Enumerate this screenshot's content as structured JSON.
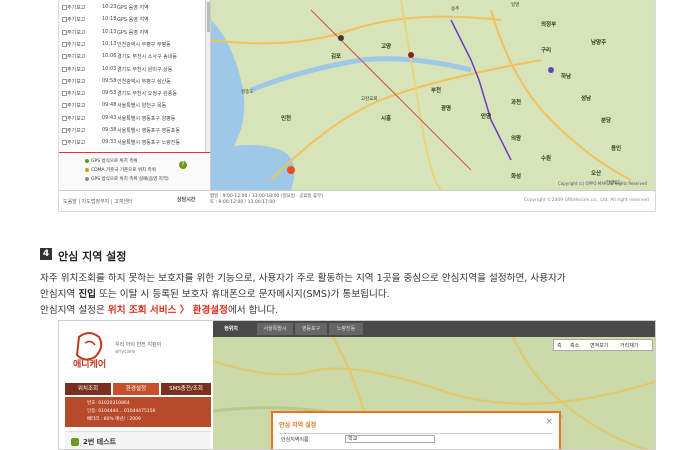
{
  "log": {
    "rows": [
      {
        "type": "주기보고",
        "time": "10:23",
        "addr": "GPS 음영 지역"
      },
      {
        "type": "주기보고",
        "time": "10:18",
        "addr": "GPS 음영 지역"
      },
      {
        "type": "주기보고",
        "time": "10:13",
        "addr": "GPS 음영 지역"
      },
      {
        "type": "주기보고",
        "time": "10:13",
        "addr": "인천광역시 부평구 부평동"
      },
      {
        "type": "주기보고",
        "time": "10:06",
        "addr": "경기도 부천시 소사구 송내동"
      },
      {
        "type": "주기보고",
        "time": "10:03",
        "addr": "경기도 부천시 원미구 상동"
      },
      {
        "type": "주기보고",
        "time": "09:58",
        "addr": "인천광역시 부평구 삼산동"
      },
      {
        "type": "주기보고",
        "time": "09:53",
        "addr": "경기도 부천시 오정구 원종동"
      },
      {
        "type": "주기보고",
        "time": "09:48",
        "addr": "서울특별시 양천구 목동"
      },
      {
        "type": "주기보고",
        "time": "09:43",
        "addr": "서울특별시 영등포구 양평동"
      },
      {
        "type": "주기보고",
        "time": "09:38",
        "addr": "서울특별시 영등포구 영등포동"
      },
      {
        "type": "주기보고",
        "time": "09:33",
        "addr": "서울특별시 영등포구 노량진동"
      }
    ],
    "legend": [
      "GPS 방식으로 위치 측위",
      "CDMA 기준국 기준으로 위치 측위",
      "GPS 방식으로 위치 측위 실패(음영 지역)"
    ],
    "help_label": "?"
  },
  "map1": {
    "places": [
      {
        "name": "송추",
        "kind": "town"
      },
      {
        "name": "일영",
        "kind": "town"
      },
      {
        "name": "의정부",
        "kind": "city"
      },
      {
        "name": "고양",
        "kind": "city"
      },
      {
        "name": "구리",
        "kind": "city"
      },
      {
        "name": "남양주",
        "kind": "city"
      },
      {
        "name": "하남",
        "kind": "city"
      },
      {
        "name": "김포",
        "kind": "city"
      },
      {
        "name": "부천",
        "kind": "city"
      },
      {
        "name": "광명",
        "kind": "city"
      },
      {
        "name": "시흥",
        "kind": "city"
      },
      {
        "name": "안양",
        "kind": "city"
      },
      {
        "name": "과천",
        "kind": "city"
      },
      {
        "name": "성남",
        "kind": "city"
      },
      {
        "name": "분당",
        "kind": "city"
      },
      {
        "name": "의왕",
        "kind": "city"
      },
      {
        "name": "수원",
        "kind": "city"
      },
      {
        "name": "용인",
        "kind": "city"
      },
      {
        "name": "오산",
        "kind": "city"
      },
      {
        "name": "화성",
        "kind": "city"
      },
      {
        "name": "인천",
        "kind": "city"
      },
      {
        "name": "영종도",
        "kind": "island"
      },
      {
        "name": "고잔교회",
        "kind": "town"
      },
      {
        "name": "한양CC",
        "kind": "poi"
      }
    ],
    "watermark": "Copyright (c) OPPO MAP. All Rights Reserved"
  },
  "footer1": {
    "links": "도움말 | 자도법정부지 | 고객센터",
    "service_label": "상담시간",
    "hours": "평일 : 9:00-12:00 / 13:00-18:00 (일요일 · 공휴일 휴무)\n토 : 9:00-12:00 / 13:00-17:00",
    "copyright": "Copyright ©2009 GRtelecom.co., Ltd. All right reserved"
  },
  "section": {
    "number": "4",
    "title": "안심 지역 설정",
    "line1": "자주 위치조회를 하지 못하는 보호자를 위한 기능으로, 사용자가 주로 활동하는 지역 1곳을 중심으로 안심지역을 설정하면, 사용자가",
    "line2_a": "안심지역 ",
    "line2_b": "진입",
    "line2_c": " 또는 이탈 시 등록된 보호자 휴대폰으로 문자메시지(SMS)가 통보됩니다.",
    "line3_a": "안심지역 설정은 ",
    "line3_b": "위치 조회 서비스 〉 환경설정",
    "line3_c": "에서 합니다."
  },
  "shot2": {
    "brand": "애니케어",
    "brand_sub": "우리 아이 안전 지킴이",
    "brand_en": "anycare",
    "tabs": [
      "위치조회",
      "환경설정",
      "SMS충전/조회"
    ],
    "card_lines": [
      "번호: 01020310864",
      "인증: 0104444... 01044475156",
      "배터리 : 80%   매년/ : 2009"
    ],
    "item": "2번 테스트",
    "map_tabs": [
      "현위치",
      "서울특별시",
      "영등포구",
      "노량진동"
    ],
    "map_tools": [
      "측",
      "축소",
      "면적보기",
      "거리재기"
    ],
    "dialog": {
      "title": "안심 지역 설정",
      "label": "안심지역이름",
      "value": "학교"
    }
  },
  "colors": {
    "accent": "#e0301e",
    "dialog": "#e9741e",
    "map_land": "#d7e3b8"
  }
}
